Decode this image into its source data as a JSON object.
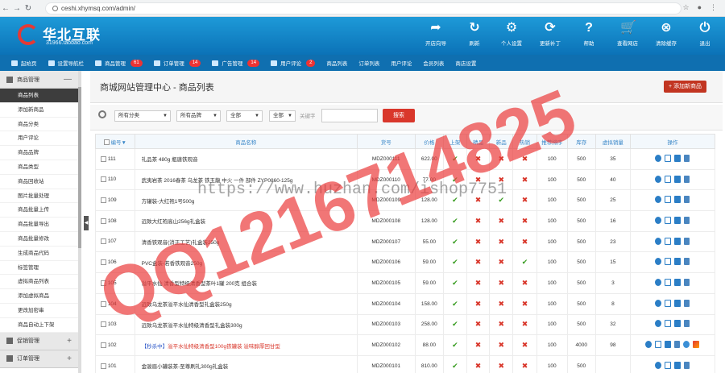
{
  "browser": {
    "url": "ceshi.xhymsq.com/admin/"
  },
  "logo": {
    "brand": "华北互联",
    "sub": "31966.taobao.com"
  },
  "toolbar": [
    {
      "label": "开店向导",
      "icon": "share-arrow-icon"
    },
    {
      "label": "刷新",
      "icon": "refresh-icon"
    },
    {
      "label": "个人设置",
      "icon": "gear-icon"
    },
    {
      "label": "更新补丁",
      "icon": "update-icon"
    },
    {
      "label": "帮助",
      "icon": "help-icon"
    },
    {
      "label": "查看网店",
      "icon": "cart-icon"
    },
    {
      "label": "清除缓存",
      "icon": "clear-icon"
    },
    {
      "label": "退出",
      "icon": "power-icon"
    }
  ],
  "nav": [
    {
      "label": "起始页"
    },
    {
      "label": "设置导航栏"
    },
    {
      "label": "商品管理",
      "badge": "61"
    },
    {
      "label": "订单管理",
      "badge": "14"
    },
    {
      "label": "广告管理",
      "badge": "14"
    },
    {
      "label": "用户评论",
      "badge": "2"
    },
    {
      "label": "商品列表"
    },
    {
      "label": "订单列表"
    },
    {
      "label": "用户评论"
    },
    {
      "label": "会员列表"
    },
    {
      "label": "商店设置"
    }
  ],
  "sidebar": {
    "group_title": "商品管理",
    "items": [
      "商品列表",
      "添加新商品",
      "商品分类",
      "用户评论",
      "商品品牌",
      "商品类型",
      "商品回收站",
      "图片批量处理",
      "商品批量上传",
      "商品批量导出",
      "商品批量修改",
      "生成商品代码",
      "标签管理",
      "虚拟商品列表",
      "添加虚拟商品",
      "更改加密串",
      "商品自动上下架"
    ],
    "groups": [
      {
        "label": "促销管理"
      },
      {
        "label": "订单管理"
      }
    ]
  },
  "page": {
    "title": "商城网站管理中心 - 商品列表",
    "add_button": "+ 添加新商品"
  },
  "filter": {
    "category": "所有分类",
    "brand": "所有品牌",
    "sel3": "全部",
    "sel4": "全部",
    "keyword_label": "关键字",
    "search_button": "搜索"
  },
  "table": {
    "headers": [
      "编号",
      "商品名称",
      "货号",
      "价格",
      "上架",
      "精品",
      "新品",
      "热销",
      "推荐排序",
      "库存",
      "虚拟销量",
      "操作"
    ],
    "rows": [
      {
        "id": "111",
        "name": "礼品茶 480g 瓶唐铁观音",
        "sn": "MDZ000111",
        "price": "622.00",
        "s": [
          1,
          0,
          0,
          0
        ],
        "order": "100",
        "stock": "500",
        "sales": "35"
      },
      {
        "id": "110",
        "name": "武夷岩茶 2016春茶 乌龙茶 铁玉龍 中火 一件 部件 ZYP0860-125g",
        "sn": "MDZ000110",
        "price": "77.00",
        "s": [
          1,
          0,
          0,
          0
        ],
        "order": "100",
        "stock": "500",
        "sales": "40"
      },
      {
        "id": "109",
        "name": "方罐装-大红袍1号500g",
        "sn": "MDZ000109",
        "price": "128.00",
        "s": [
          1,
          0,
          1,
          0
        ],
        "order": "100",
        "stock": "500",
        "sales": "25"
      },
      {
        "id": "108",
        "name": "远致大红袍高山256g礼盒装",
        "sn": "MDZ000108",
        "price": "128.00",
        "s": [
          1,
          0,
          0,
          0
        ],
        "order": "100",
        "stock": "500",
        "sales": "16"
      },
      {
        "id": "107",
        "name": "清香铁观音(消正工艺)礼盒装250g",
        "sn": "MDZ000107",
        "price": "55.00",
        "s": [
          1,
          0,
          0,
          0
        ],
        "order": "100",
        "stock": "500",
        "sales": "23"
      },
      {
        "id": "106",
        "name": "PVC盒装-若香铁观音250g",
        "sn": "MDZ000106",
        "price": "59.00",
        "s": [
          1,
          0,
          0,
          1
        ],
        "order": "100",
        "stock": "500",
        "sales": "15"
      },
      {
        "id": "105",
        "name": "溢平水仙 清香型特级清香型茶叶1罐 200克 组合装",
        "sn": "MDZ000105",
        "price": "59.00",
        "s": [
          1,
          0,
          0,
          0
        ],
        "order": "100",
        "stock": "500",
        "sales": "3"
      },
      {
        "id": "104",
        "name": "远致乌龙茶溢平水仙清香型礼盒装250g",
        "sn": "MDZ000104",
        "price": "158.00",
        "s": [
          1,
          0,
          0,
          0
        ],
        "order": "100",
        "stock": "500",
        "sales": "8"
      },
      {
        "id": "103",
        "name": "远致乌龙茶溢平水仙特级清香型礼盒装300g",
        "sn": "MDZ000103",
        "price": "258.00",
        "s": [
          1,
          0,
          0,
          0
        ],
        "order": "100",
        "stock": "500",
        "sales": "32"
      },
      {
        "id": "102",
        "name_prefix": "【秒杀中】",
        "name": "溢平水仙特级清香型100g铁罐装 溢味醇厚回甘型",
        "sn": "MDZ000102",
        "price": "88.00",
        "s": [
          1,
          0,
          0,
          0
        ],
        "order": "100",
        "stock": "4000",
        "sales": "98",
        "red": true
      },
      {
        "id": "101",
        "name": "金骏眉小罐装茶-至尊刷礼300g礼盒装",
        "sn": "MDZ000101",
        "price": "810.00",
        "s": [
          1,
          0,
          0,
          0
        ],
        "order": "100",
        "stock": "500",
        "sales": ""
      }
    ]
  },
  "watermark": {
    "url": "https://www.huzhan.com/ishop7751",
    "qq": "QQ1216714825"
  },
  "colors": {
    "top_bar": "#1a8fd2",
    "nav": "#0f6fb0",
    "accent_red": "#c23521",
    "ok": "#3a9d23",
    "no": "#d9372b"
  }
}
